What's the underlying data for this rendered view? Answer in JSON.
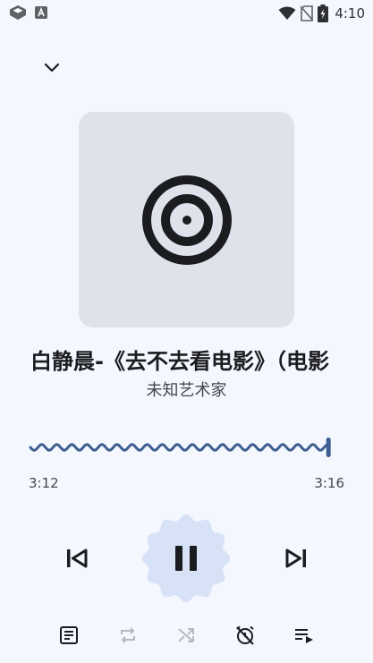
{
  "status_bar": {
    "time": "4:10",
    "left_icons": [
      "app-notification-icon",
      "a-notification-icon"
    ],
    "right_icons": [
      "wifi-icon",
      "no-sim-icon",
      "battery-icon"
    ]
  },
  "header": {
    "collapse_icon": "chevron-down-icon"
  },
  "now_playing": {
    "title": "白静晨-《去不去看电影》（电影",
    "artist": "未知艺术家",
    "cover_icon": "vinyl-disc-icon"
  },
  "progress": {
    "current_time": "3:12",
    "total_time": "3:16",
    "fraction": 0.98
  },
  "controls": {
    "prev_icon": "skip-previous-icon",
    "play_pause_icon": "pause-icon",
    "next_icon": "skip-next-icon"
  },
  "bottom_bar": {
    "items": [
      "lyrics-icon",
      "repeat-icon",
      "shuffle-icon",
      "sleep-timer-off-icon",
      "queue-icon"
    ]
  },
  "colors": {
    "background": "#f5f7ff",
    "accent": "#3d5f8f",
    "play_button_bg": "#d8e2f7"
  }
}
